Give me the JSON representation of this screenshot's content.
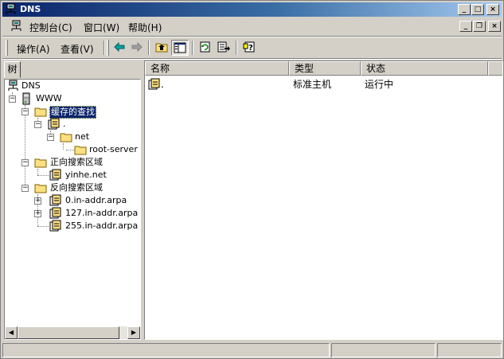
{
  "window": {
    "title": "DNS"
  },
  "menubar": {
    "items": [
      {
        "label": "控制台(C)"
      },
      {
        "label": "窗口(W)"
      },
      {
        "label": "帮助(H)"
      }
    ]
  },
  "toolbar": {
    "action_label": "操作(A)",
    "view_label": "查看(V)"
  },
  "tree": {
    "tab_label": "树",
    "items": [
      {
        "label": "DNS"
      },
      {
        "label": "WWW"
      },
      {
        "label": "缓存的查找"
      },
      {
        "label": "."
      },
      {
        "label": "net"
      },
      {
        "label": "root-server"
      },
      {
        "label": "正向搜索区域"
      },
      {
        "label": "yinhe.net"
      },
      {
        "label": "反向搜索区域"
      },
      {
        "label": "0.in-addr.arpa"
      },
      {
        "label": "127.in-addr.arpa"
      },
      {
        "label": "255.in-addr.arpa"
      }
    ],
    "selected_index": 2
  },
  "list": {
    "columns": [
      "名称",
      "类型",
      "状态"
    ],
    "rows": [
      {
        "name": ".",
        "type": "标准主机",
        "status": "运行中"
      }
    ]
  },
  "colors": {
    "title_start": "#0a246a",
    "title_end": "#a6caf0",
    "selection": "#0a246a",
    "chrome": "#d4d0c8"
  }
}
